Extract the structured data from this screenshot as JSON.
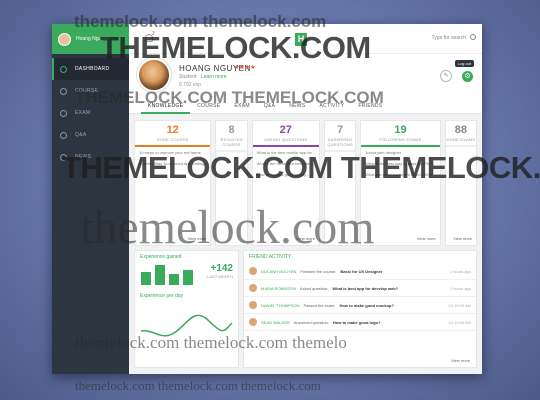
{
  "user": {
    "name": "HOANG NGUYEN",
    "role": "Student",
    "learn_more": "Learn more",
    "xp": "8,792 exp",
    "sidebar_label": "Hoang Nguyen"
  },
  "search": {
    "placeholder": "Type for search"
  },
  "notifications": {
    "count": "2"
  },
  "logo": {
    "letter": "H"
  },
  "logout": "Log out",
  "sidebar": {
    "items": [
      {
        "label": "DASHBOARD",
        "icon": "dashboard-icon",
        "active": true
      },
      {
        "label": "COURSE",
        "icon": "course-icon"
      },
      {
        "label": "EXAM",
        "icon": "exam-icon"
      },
      {
        "label": "Q&A",
        "icon": "qa-icon"
      },
      {
        "label": "NEWS",
        "icon": "news-icon"
      }
    ]
  },
  "tabs": [
    "KNOWLEDGE",
    "COURSE",
    "EXAM",
    "Q&A",
    "NEWS",
    "ACTIVITY",
    "FRIENDS"
  ],
  "stats": [
    {
      "num": "12",
      "label": "DONE COURSE",
      "color": "#e67e22",
      "rows": [
        "10 steps to improve your ent frame",
        "A Better Way To Account App Settings"
      ]
    },
    {
      "num": "8",
      "label": "REGISTED COURSE",
      "color": "#999999",
      "rows": []
    },
    {
      "num": "27",
      "label": "ASKING QUESTIONS",
      "color": "#8e44ad",
      "rows": [
        "What is the best mobile app for...",
        "What's the difference between...",
        "How to make a good quality..."
      ]
    },
    {
      "num": "7",
      "label": "ANSWERED QUESTIONS",
      "color": "#999999",
      "rows": []
    },
    {
      "num": "19",
      "label": "FOLLOWING EXAMS",
      "color": "#3aaa5c",
      "rows": [
        "Junior web designer",
        "What is the best way to pass the PMP...",
        "What are good examples of ind UX/UI..."
      ]
    },
    {
      "num": "88",
      "label": "DONE EXAMS",
      "color": "#888888",
      "rows": []
    }
  ],
  "view_more": "View more",
  "experience": {
    "title": "Experience gained",
    "gain": "+142",
    "period": "LAST MONTH",
    "bars": [
      0.6,
      0.9,
      0.5,
      0.7
    ],
    "title2": "Experience per day"
  },
  "activity": {
    "title": "FRIEND ACTIVITY",
    "items": [
      {
        "who": "DUCANH NGUYEN",
        "action": "Finished the course:",
        "target": "Basic for UX Designer",
        "time": "1 hours ago"
      },
      {
        "who": "MARIA ROBINSON",
        "action": "Asked question:",
        "target": "What is best app for develop web?",
        "time": "1 hours ago"
      },
      {
        "who": "DANIEL THOMPSON",
        "action": "Passed the exam:",
        "target": "How to make good mockup?",
        "time": "10:19:30 AM"
      },
      {
        "who": "SEAN WALKER",
        "action": "Answered question:",
        "target": "How to make good logo?",
        "time": "10:19:30 AM"
      }
    ]
  },
  "watermark": {
    "a": "themelock.com themelock.com",
    "b": "THEMELOCK.COM",
    "c": "THEMELOCK.COM THEMELOCK.COM",
    "d": "themelock.com",
    "e": "themelock.com themelock.com themelo",
    "f": "themelock.com themelock.com themelock.com"
  }
}
